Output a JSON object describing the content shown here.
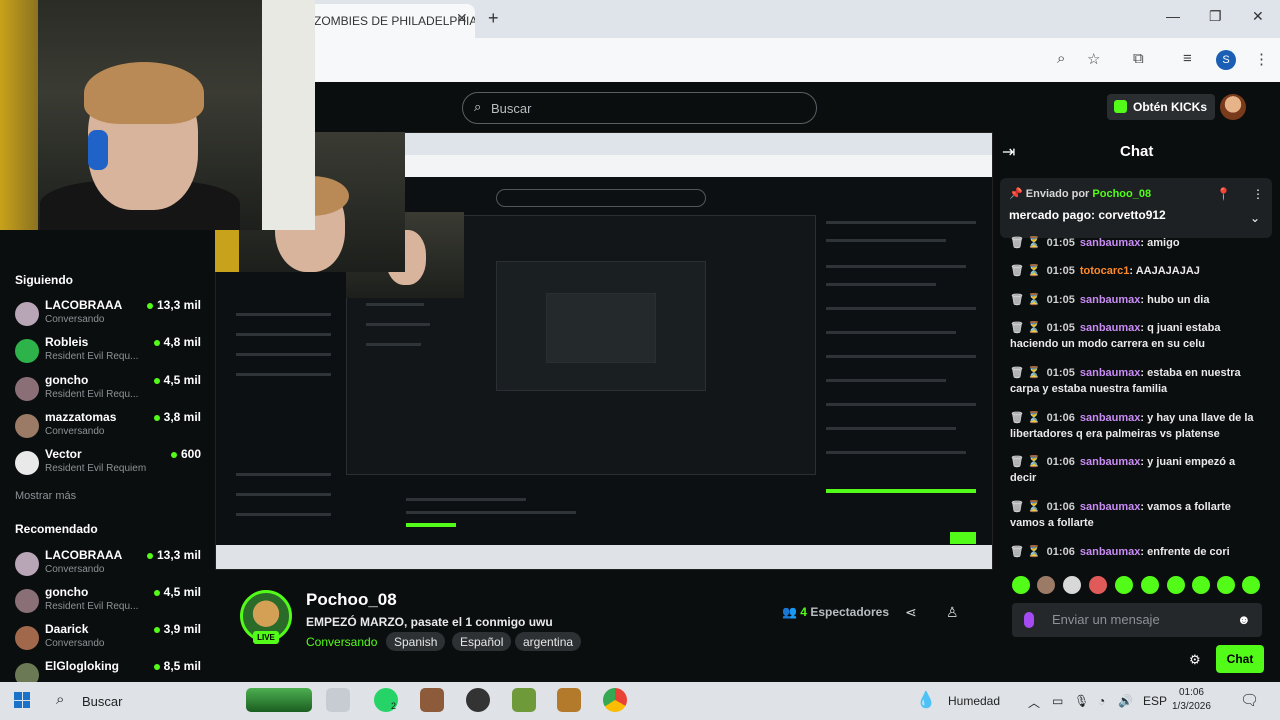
{
  "browser": {
    "tab_title": "ZOMBIES DE PHILADELPHIA",
    "tab_close": "✕",
    "new_tab": "+",
    "window_controls": [
      "—",
      "❐",
      "✕"
    ],
    "toolbar_icons": [
      "zoom-icon",
      "star-icon",
      "extensions-icon",
      "media-icon",
      "profile-icon",
      "menu-icon"
    ],
    "profile_initial": "S"
  },
  "header": {
    "search_placeholder": "Buscar",
    "kicks_label": "Obtén KICKs"
  },
  "sidebar": {
    "following_title": "Siguiendo",
    "following": [
      {
        "name": "LACOBRAAA",
        "sub": "Conversando",
        "count": "13,3 mil",
        "color": "#b8a5b5"
      },
      {
        "name": "Robleis",
        "sub": "Resident Evil Requ...",
        "count": "4,8 mil",
        "color": "#2db34a"
      },
      {
        "name": "goncho",
        "sub": "Resident Evil Requ...",
        "count": "4,5 mil",
        "color": "#8a6f77"
      },
      {
        "name": "mazzatomas",
        "sub": "Conversando",
        "count": "3,8 mil",
        "color": "#9c7b66"
      },
      {
        "name": "Vector",
        "sub": "Resident Evil Requiem",
        "count": "600",
        "color": "#e9e9e9"
      }
    ],
    "show_more": "Mostrar más",
    "recommended_title": "Recomendado",
    "recommended": [
      {
        "name": "LACOBRAAA",
        "sub": "Conversando",
        "count": "13,3 mil",
        "color": "#b8a5b5"
      },
      {
        "name": "goncho",
        "sub": "Resident Evil Requ...",
        "count": "4,5 mil",
        "color": "#8a6f77"
      },
      {
        "name": "Daarick",
        "sub": "Conversando",
        "count": "3,9 mil",
        "color": "#a1684c"
      },
      {
        "name": "ElGlogloking",
        "sub": "",
        "count": "8,5 mil",
        "color": "#6b7a55"
      }
    ]
  },
  "stream": {
    "name": "Pochoo_08",
    "live_badge": "LIVE",
    "title": "EMPEZÓ MARZO, pasate el 1 conmigo uwu",
    "category": "Conversando",
    "tags": [
      "Spanish",
      "Español",
      "argentina"
    ],
    "viewer_count": "4",
    "viewer_label": "Espectadores"
  },
  "chat": {
    "title": "Chat",
    "pinned_by_label": "Enviado por",
    "pinned_user": "Pochoo_08",
    "pinned_message": "mercado pago: corvetto912",
    "messages": [
      {
        "time": "01:05",
        "user": "sanbaumax",
        "text": "amigo",
        "orange": false
      },
      {
        "time": "01:05",
        "user": "totocarc1",
        "text": "AAJAJAJAJ",
        "orange": true
      },
      {
        "time": "01:05",
        "user": "sanbaumax",
        "text": "hubo un dia",
        "orange": false
      },
      {
        "time": "01:05",
        "user": "sanbaumax",
        "text": "q juani estaba haciendo un modo carrera en su celu",
        "orange": false
      },
      {
        "time": "01:05",
        "user": "sanbaumax",
        "text": "estaba en nuestra carpa y estaba nuestra familia",
        "orange": false
      },
      {
        "time": "01:06",
        "user": "sanbaumax",
        "text": "y hay una llave de la libertadores q era palmeiras vs platense",
        "orange": false
      },
      {
        "time": "01:06",
        "user": "sanbaumax",
        "text": "y juani empezó a decir",
        "orange": false
      },
      {
        "time": "01:06",
        "user": "sanbaumax",
        "text": "vamos a follarte vamos a follarte",
        "orange": false
      },
      {
        "time": "01:06",
        "user": "sanbaumax",
        "text": "enfrente de cori",
        "orange": false
      }
    ],
    "input_placeholder": "Enviar un mensaje",
    "send_label": "Chat"
  },
  "taskbar": {
    "search_label": "Buscar",
    "weather_label": "Humedad",
    "language": "ESP",
    "time": "01:06",
    "date": "1/3/2026",
    "whatsapp_badge": "2",
    "apps": [
      {
        "name": "landscape-widget",
        "color": "#4caf50"
      },
      {
        "name": "task-view",
        "color": "#9aa0a6"
      },
      {
        "name": "whatsapp",
        "color": "#25d366"
      },
      {
        "name": "game-app",
        "color": "#8d5a3a"
      },
      {
        "name": "record-app",
        "color": "#333333"
      },
      {
        "name": "minecraft",
        "color": "#6f9a3a"
      },
      {
        "name": "max-app",
        "color": "#b27a2a"
      },
      {
        "name": "chrome",
        "color": "#e94235"
      }
    ]
  },
  "colors": {
    "accent": "#53fc18",
    "chat_user": "#c98cf5",
    "chat_user_alt": "#ff8a2a",
    "background": "#0b0e0f"
  }
}
